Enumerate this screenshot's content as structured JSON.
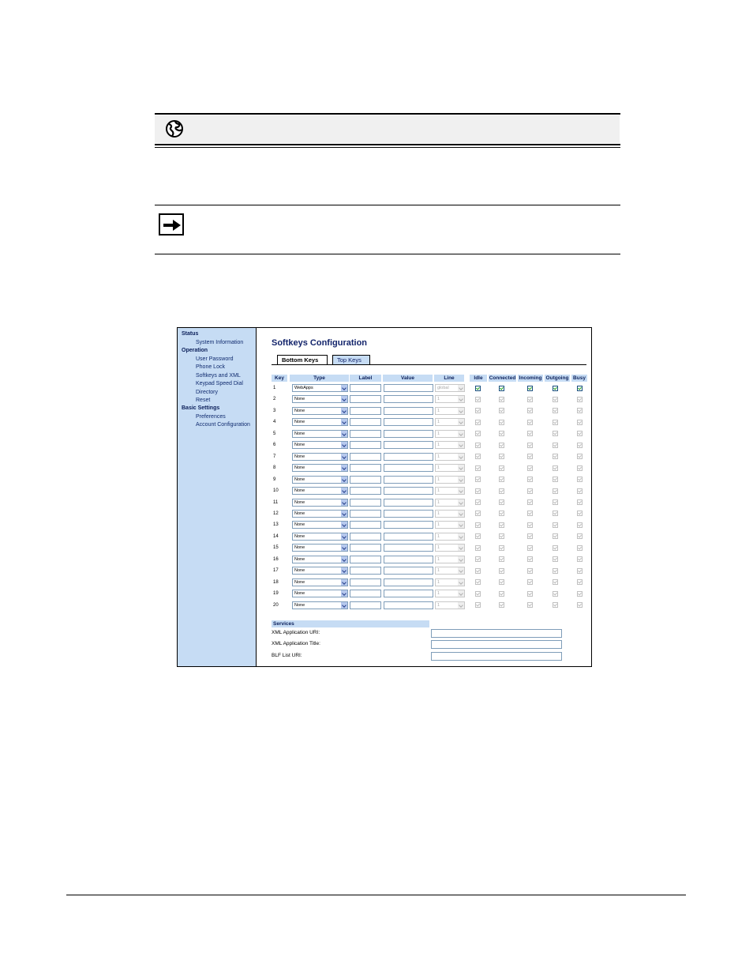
{
  "sidebar": {
    "sections": [
      {
        "label": "Status",
        "items": [
          "System Information"
        ]
      },
      {
        "label": "Operation",
        "items": [
          "User Password",
          "Phone Lock",
          "Softkeys and XML",
          "Keypad Speed Dial",
          "Directory",
          "Reset"
        ]
      },
      {
        "label": "Basic Settings",
        "items": [
          "Preferences",
          "Account Configuration"
        ]
      }
    ]
  },
  "page": {
    "title": "Softkeys Configuration",
    "tabs": [
      {
        "label": "Bottom Keys",
        "active": true
      },
      {
        "label": "Top Keys",
        "active": false
      }
    ]
  },
  "table": {
    "headers": [
      "Key",
      "Type",
      "Label",
      "Value",
      "Line",
      "Idle",
      "Connected",
      "Incoming",
      "Outgoing",
      "Busy"
    ],
    "rows": [
      {
        "key": "1",
        "type": "WebApps",
        "line": "global",
        "enabled": true
      },
      {
        "key": "2",
        "type": "None",
        "line": "1",
        "enabled": false
      },
      {
        "key": "3",
        "type": "None",
        "line": "1",
        "enabled": false
      },
      {
        "key": "4",
        "type": "None",
        "line": "1",
        "enabled": false
      },
      {
        "key": "5",
        "type": "None",
        "line": "1",
        "enabled": false
      },
      {
        "key": "6",
        "type": "None",
        "line": "1",
        "enabled": false
      },
      {
        "key": "7",
        "type": "None",
        "line": "1",
        "enabled": false
      },
      {
        "key": "8",
        "type": "None",
        "line": "1",
        "enabled": false
      },
      {
        "key": "9",
        "type": "None",
        "line": "1",
        "enabled": false
      },
      {
        "key": "10",
        "type": "None",
        "line": "1",
        "enabled": false
      },
      {
        "key": "11",
        "type": "None",
        "line": "1",
        "enabled": false
      },
      {
        "key": "12",
        "type": "None",
        "line": "1",
        "enabled": false
      },
      {
        "key": "13",
        "type": "None",
        "line": "1",
        "enabled": false
      },
      {
        "key": "14",
        "type": "None",
        "line": "1",
        "enabled": false
      },
      {
        "key": "15",
        "type": "None",
        "line": "1",
        "enabled": false
      },
      {
        "key": "16",
        "type": "None",
        "line": "1",
        "enabled": false
      },
      {
        "key": "17",
        "type": "None",
        "line": "1",
        "enabled": false
      },
      {
        "key": "18",
        "type": "None",
        "line": "1",
        "enabled": false
      },
      {
        "key": "19",
        "type": "None",
        "line": "1",
        "enabled": false
      },
      {
        "key": "20",
        "type": "None",
        "line": "1",
        "enabled": false
      }
    ]
  },
  "services": {
    "heading": "Services",
    "fields": [
      {
        "label": "XML Application URI:",
        "value": ""
      },
      {
        "label": "XML Application Title:",
        "value": ""
      },
      {
        "label": "BLF List URI:",
        "value": ""
      }
    ]
  },
  "icons": {
    "web_note": "globe-icon",
    "note": "arrow-right-icon"
  },
  "colors": {
    "sidebar_bg": "#c6dcf4",
    "header_bg": "#c6dcf4",
    "title_text": "#13246b",
    "check_green": "#21a121"
  }
}
